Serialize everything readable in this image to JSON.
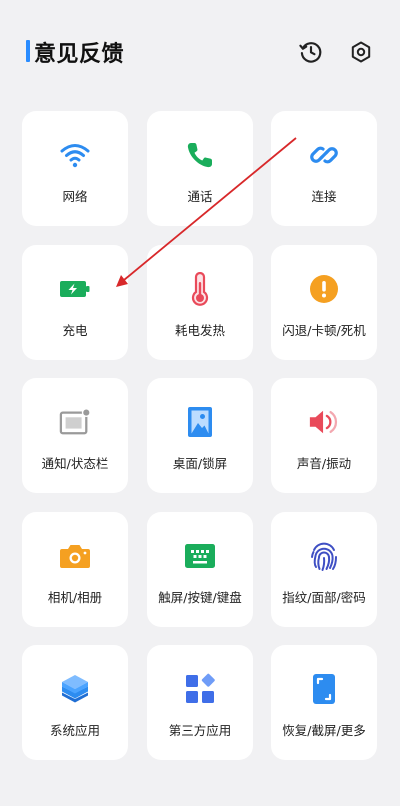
{
  "header": {
    "title": "意见反馈",
    "history_icon": "history-icon",
    "settings_icon": "settings-icon"
  },
  "categories": [
    {
      "label": "网络",
      "icon": "wifi-icon"
    },
    {
      "label": "通话",
      "icon": "phone-icon"
    },
    {
      "label": "连接",
      "icon": "link-icon"
    },
    {
      "label": "充电",
      "icon": "battery-charging-icon"
    },
    {
      "label": "耗电发热",
      "icon": "thermometer-icon"
    },
    {
      "label": "闪退/卡顿/死机",
      "icon": "alert-icon"
    },
    {
      "label": "通知/状态栏",
      "icon": "notification-icon"
    },
    {
      "label": "桌面/锁屏",
      "icon": "wallpaper-icon"
    },
    {
      "label": "声音/振动",
      "icon": "speaker-icon"
    },
    {
      "label": "相机/相册",
      "icon": "camera-icon"
    },
    {
      "label": "触屏/按键/键盘",
      "icon": "keyboard-icon"
    },
    {
      "label": "指纹/面部/密码",
      "icon": "fingerprint-icon"
    },
    {
      "label": "系统应用",
      "icon": "layers-icon"
    },
    {
      "label": "第三方应用",
      "icon": "apps-icon"
    },
    {
      "label": "恢复/截屏/更多",
      "icon": "screenshot-icon"
    }
  ],
  "colors": {
    "accent": "#2a8cff",
    "network_blue": "#2d8cf0",
    "phone_green": "#1aad5b",
    "battery_green": "#1aad5b",
    "thermo_red": "#e94a5a",
    "alert_orange": "#f5a021",
    "gray": "#9a9a9a",
    "red_annotation": "#d8282a"
  }
}
